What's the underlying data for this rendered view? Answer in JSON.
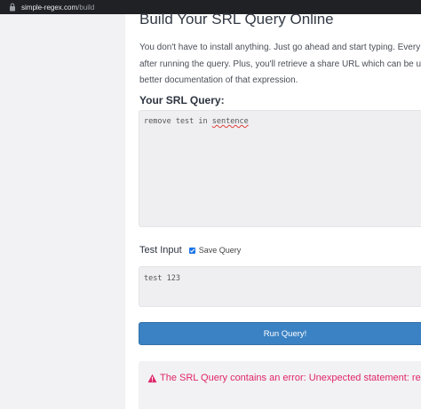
{
  "browser": {
    "url_domain": "simple-regex.com",
    "url_path": "/build"
  },
  "main": {
    "title": "Build Your SRL Query Online",
    "description_lines": [
      "You don't have to install anything. Just go ahead and start typing. Every SRL Query will",
      "after running the query. Plus, you'll retrieve a share URL which can be used to link to th",
      "better documentation of that expression."
    ],
    "query_label": "Your SRL Query:",
    "query_prefix": "remove test in ",
    "query_misspelled": "sentence",
    "test_input_label": "Test Input",
    "save_query_label": "Save Query",
    "save_query_checked": true,
    "test_input_value": "test 123",
    "run_button_label": "Run Query!",
    "error_message": "The SRL Query contains an error: Unexpected statement: remove"
  },
  "colors": {
    "accent": "#3b82c4",
    "error": "#e0256a",
    "sidebar": "#f2f2f5"
  },
  "icons": {
    "address_bar": "lock-icon",
    "error": "warning-icon",
    "checkbox": "checkmark-icon"
  }
}
